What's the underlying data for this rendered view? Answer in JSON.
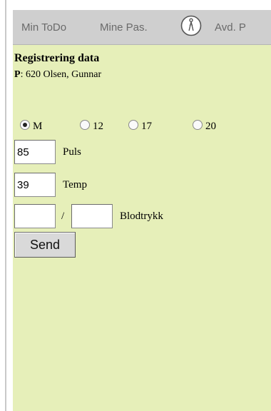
{
  "nav": {
    "tabs": [
      "Min ToDo",
      "Mine Pas.",
      "Avd. P"
    ],
    "logo_icon": "walking-figure-logo-icon"
  },
  "form": {
    "title": "Registrering data",
    "patient_prefix": "P",
    "patient_text": ": 620 Olsen, Gunnar",
    "radios": [
      {
        "label": "M",
        "checked": true
      },
      {
        "label": "12",
        "checked": false
      },
      {
        "label": "17",
        "checked": false
      },
      {
        "label": "20",
        "checked": false
      }
    ],
    "puls": {
      "value": "85",
      "label": "Puls"
    },
    "temp": {
      "value": "39",
      "label": "Temp"
    },
    "blood_pressure": {
      "systolic": "",
      "diastolic": "",
      "separator": "/",
      "label": "Blodtrykk"
    },
    "send_label": "Send"
  },
  "colors": {
    "content_background": "#e6efb9",
    "tabbar_background": "#cfcfcf",
    "tab_text": "#6a6a6a"
  }
}
